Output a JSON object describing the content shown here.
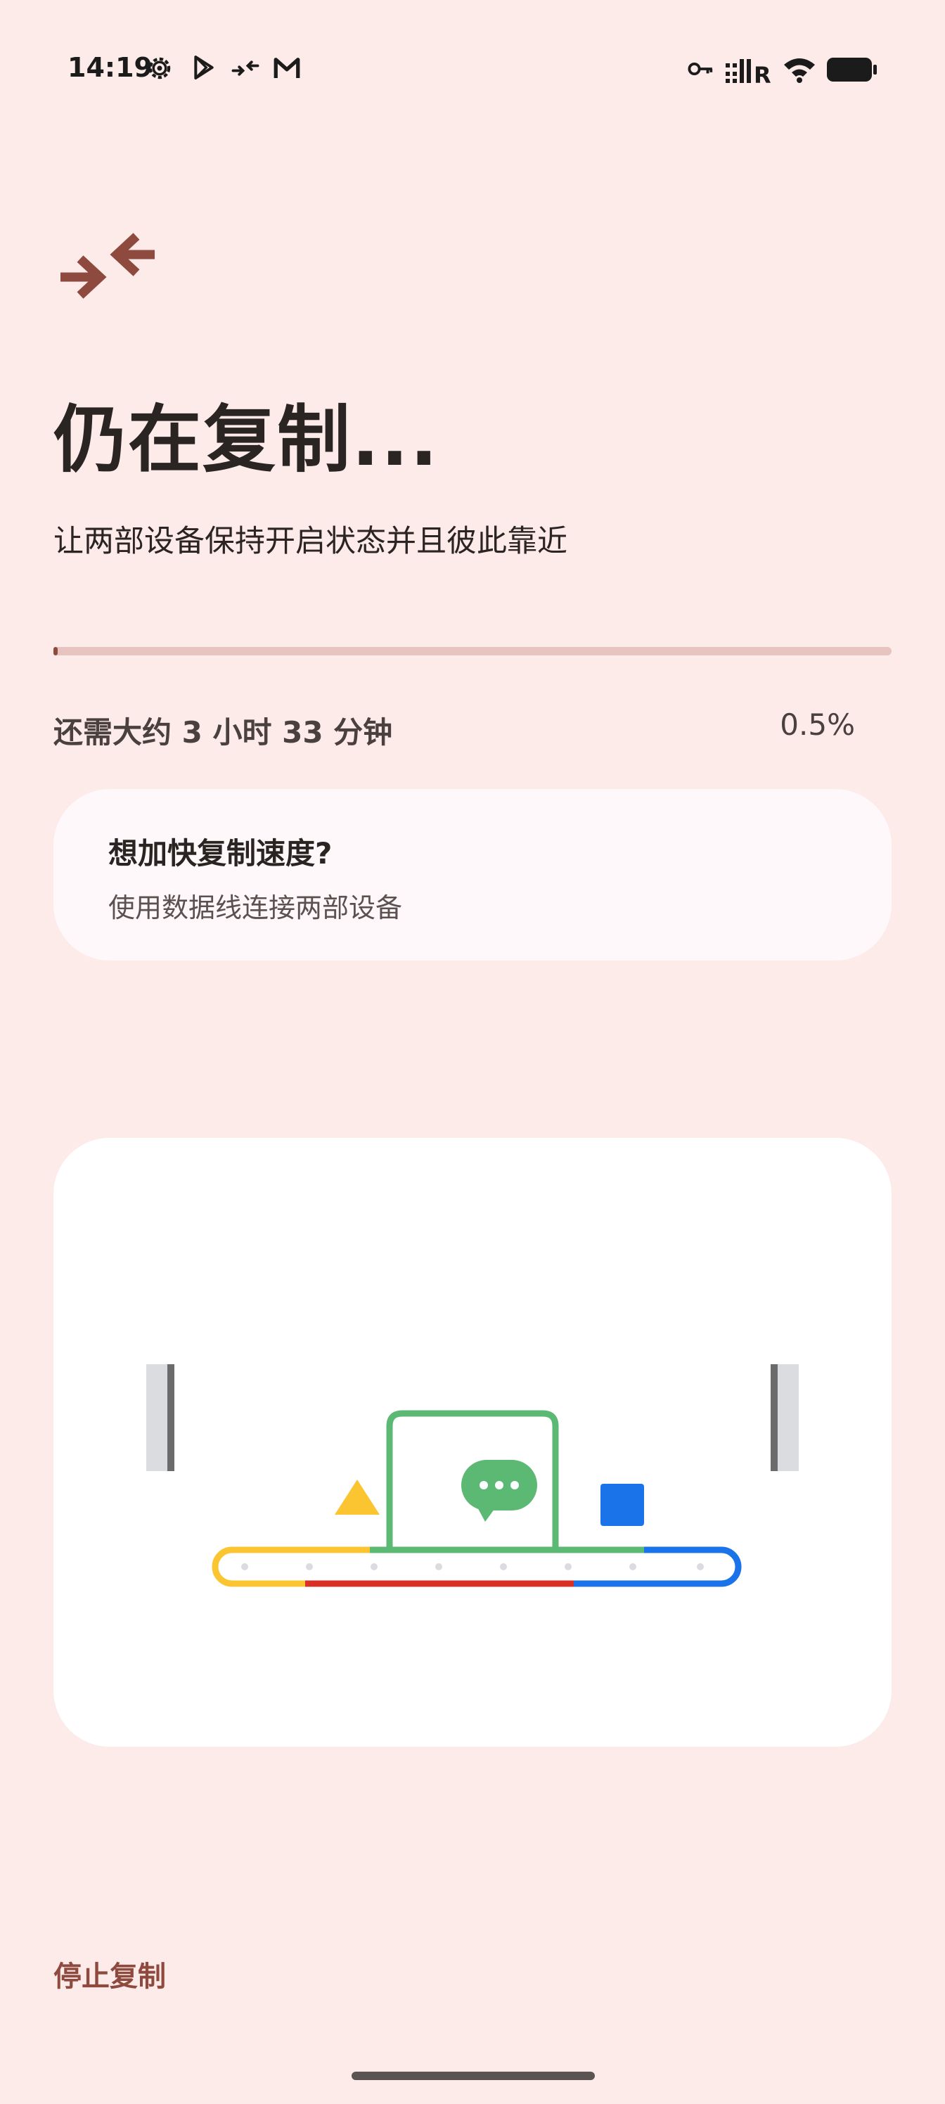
{
  "status_bar": {
    "time": "14:19",
    "left_icons": [
      "settings-icon",
      "play-store-icon",
      "nearby-share-icon",
      "gmail-icon"
    ],
    "right_icons": [
      "vpn-key-icon",
      "signal-icon",
      "wifi-icon",
      "battery-icon"
    ]
  },
  "header": {
    "icon": "data-transfer-icon",
    "title": "仍在复制...",
    "subtitle": "让两部设备保持开启状态并且彼此靠近"
  },
  "progress": {
    "remaining_text": "还需大约 3 小时 33 分钟",
    "percent_text": "0.5%",
    "fraction": 0.005
  },
  "speed_tip": {
    "title": "想加快复制速度?",
    "subtitle": "使用数据线连接两部设备"
  },
  "illustration": {
    "name": "conveyor-transfer-illustration",
    "colors": {
      "yellow": "#fbc431",
      "red": "#d93025",
      "blue": "#1a73e8",
      "green": "#5bb974",
      "grey": "#6b6b6b"
    }
  },
  "footer": {
    "stop_label": "停止复制"
  },
  "theme": {
    "background": "#fcebe8",
    "accent": "#8e4a3f",
    "card": "#fff8fa"
  }
}
